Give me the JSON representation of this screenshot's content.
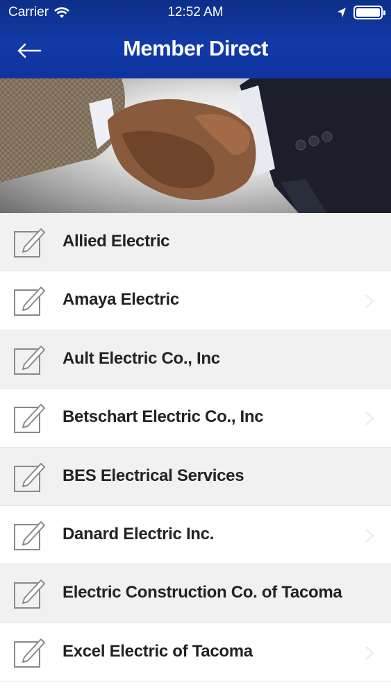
{
  "status_bar": {
    "carrier": "Carrier",
    "time": "12:52 AM",
    "icons": [
      "wifi-icon",
      "location-arrow-icon",
      "battery-icon"
    ]
  },
  "nav": {
    "title": "Member Direct",
    "back_icon": "back-arrow-icon",
    "color": "#123aa6"
  },
  "hero": {
    "image": "handshake-photo"
  },
  "members": [
    {
      "name": "Allied Electric",
      "icon": "edit-icon"
    },
    {
      "name": "Amaya Electric",
      "icon": "edit-icon"
    },
    {
      "name": "Ault Electric Co., Inc",
      "icon": "edit-icon"
    },
    {
      "name": "Betschart Electric Co., Inc",
      "icon": "edit-icon"
    },
    {
      "name": "BES Electrical Services",
      "icon": "edit-icon"
    },
    {
      "name": "Danard Electric Inc.",
      "icon": "edit-icon"
    },
    {
      "name": "Electric Construction Co. of Tacoma",
      "icon": "edit-icon"
    },
    {
      "name": "Excel Electric of Tacoma",
      "icon": "edit-icon"
    }
  ],
  "colors": {
    "header_blue": "#123aa6",
    "row_alt": "#f1f1f1",
    "text": "#222222"
  }
}
